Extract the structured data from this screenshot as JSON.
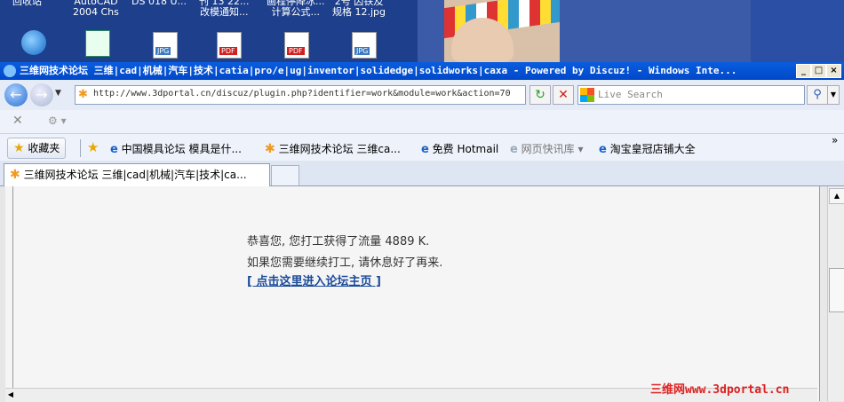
{
  "desktop": {
    "top_labels": [
      {
        "text": "回收站"
      },
      {
        "text": "AutoCAD\n2004 Chs"
      },
      {
        "text": "DS 018 U..."
      },
      {
        "text": "刊 13 22...\n改模通知..."
      },
      {
        "text": "画程停降冰...\n计算公式..."
      },
      {
        "text": "2号 因铁及\n规格 12.jpg"
      }
    ],
    "icons": [
      {
        "type": "ie"
      },
      {
        "type": "cad"
      },
      {
        "type": "jpg",
        "tag": "JPG"
      },
      {
        "type": "pdf",
        "tag": "PDF"
      },
      {
        "type": "pdf",
        "tag": "PDF"
      },
      {
        "type": "jpg",
        "tag": "JPG"
      }
    ]
  },
  "window": {
    "title": "三维网技术论坛 三维|cad|机械|汽车|技术|catia|pro/e|ug|inventor|solidedge|solidworks|caxa - Powered by Discuz! - Windows Inte...",
    "buttons": {
      "minimize": "_",
      "maximize": "□",
      "close": "×"
    }
  },
  "address_bar": {
    "url": "http://www.3dportal.cn/discuz/plugin.php?identifier=work&module=work&action=70"
  },
  "search": {
    "placeholder": "Live Search"
  },
  "favorites_bar": {
    "favorites_label": "收藏夹",
    "items": [
      {
        "label": "中国模具论坛 模具是什..."
      },
      {
        "label": "三维网技术论坛 三维ca..."
      },
      {
        "label": "免费 Hotmail"
      },
      {
        "label": "网页快讯库 ▾"
      },
      {
        "label": "淘宝皇冠店铺大全"
      }
    ]
  },
  "tabs": [
    {
      "label": "三维网技术论坛 三维|cad|机械|汽车|技术|ca..."
    }
  ],
  "content": {
    "line1": "恭喜您, 您打工获得了流量 4889 K.",
    "line2": "如果您需要继续打工, 请休息好了再来.",
    "link": "[ 点击这里进入论坛主页 ]"
  },
  "watermark": "三维网www.3dportal.cn",
  "colors": {
    "title_bar": "#0a5de0",
    "link": "#1a4a9a",
    "watermark": "#e02020"
  }
}
